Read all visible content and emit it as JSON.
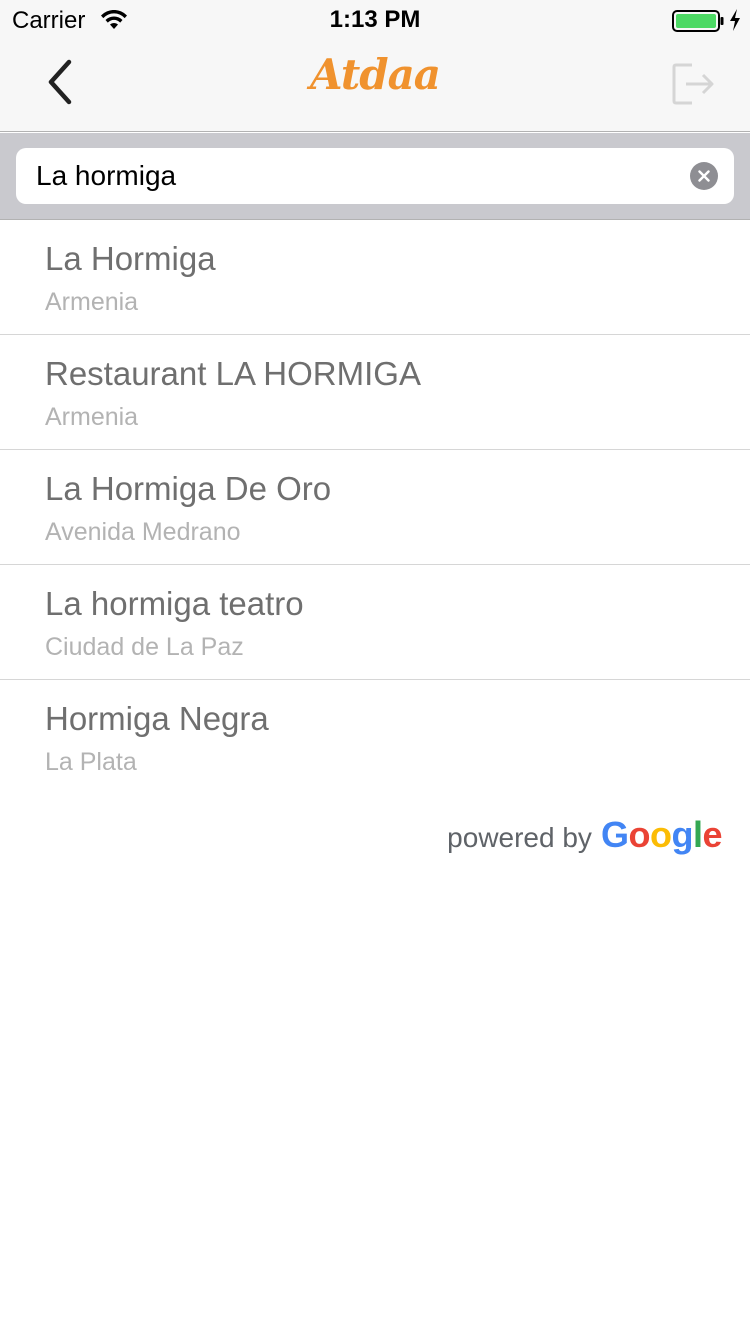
{
  "status_bar": {
    "carrier": "Carrier",
    "time": "1:13 PM",
    "battery_level": 1.0,
    "battery_color": "#4cd964"
  },
  "nav": {
    "logo_text": "Atdaa",
    "logo_color": "#f0922e",
    "back_icon": "chevron-left-icon",
    "logout_icon": "logout-icon"
  },
  "search": {
    "value": "La hormiga",
    "clear_icon": "clear-icon"
  },
  "results": [
    {
      "name": "La Hormiga",
      "area": "Armenia"
    },
    {
      "name": "Restaurant LA HORMIGA",
      "area": "Armenia"
    },
    {
      "name": "La Hormiga De Oro",
      "area": "Avenida Medrano"
    },
    {
      "name": "La hormiga teatro",
      "area": "Ciudad de La Paz"
    },
    {
      "name": "Hormiga Negra",
      "area": "La Plata"
    }
  ],
  "attribution": {
    "prefix": "powered by",
    "brand_letters": [
      "G",
      "o",
      "o",
      "g",
      "l",
      "e"
    ]
  }
}
